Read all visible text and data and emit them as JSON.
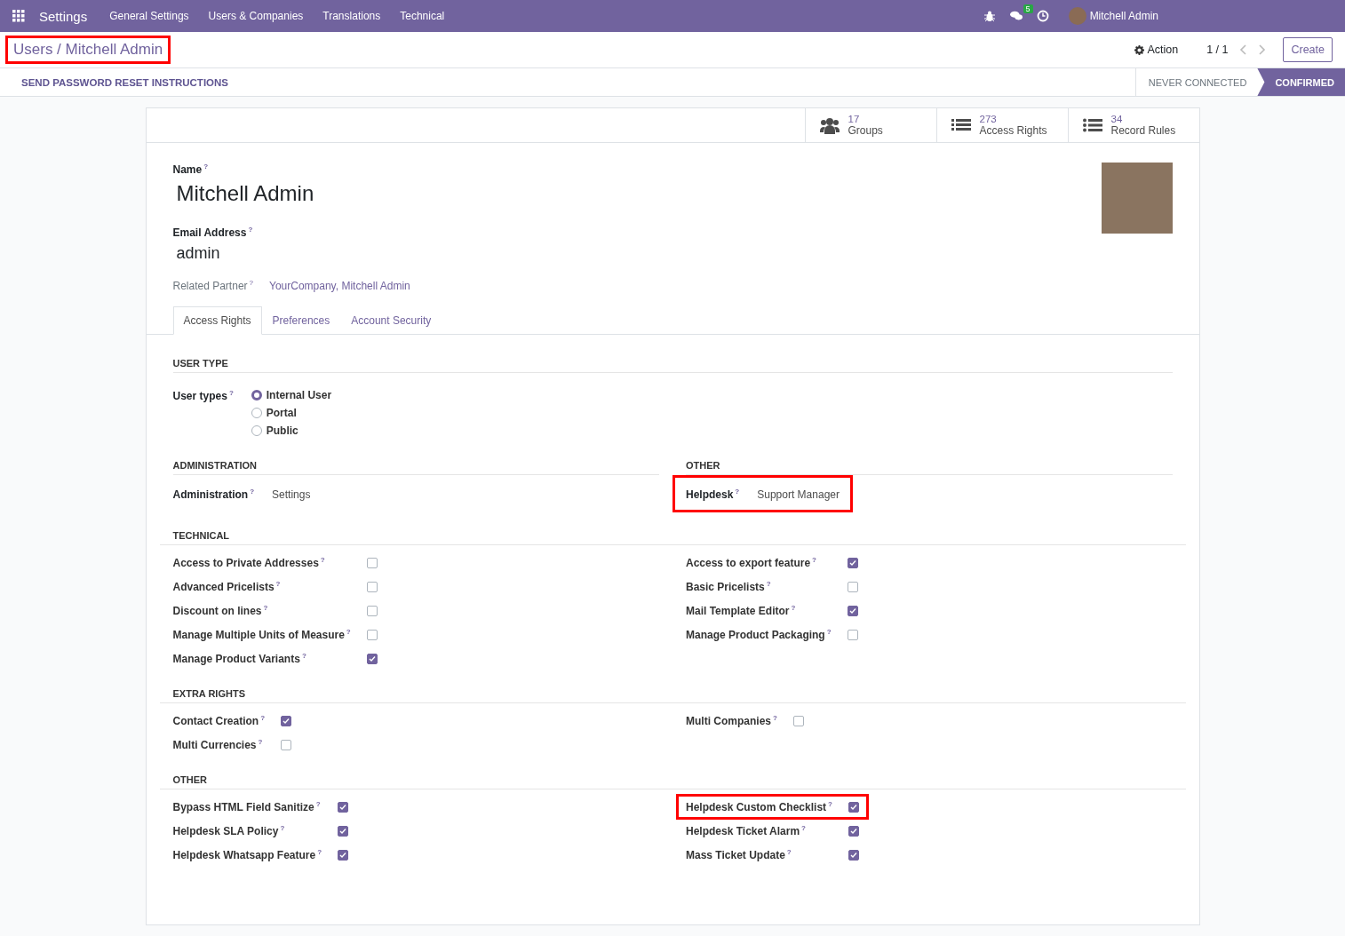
{
  "navbar": {
    "app_name": "Settings",
    "menu": [
      "General Settings",
      "Users & Companies",
      "Translations",
      "Technical"
    ],
    "chat_badge": "5",
    "user_name": "Mitchell Admin"
  },
  "control_panel": {
    "breadcrumb": "Users / Mitchell Admin",
    "breadcrumb_highlighted": true,
    "action": "Action",
    "pager": "1 / 1",
    "create": "Create"
  },
  "status_bar": {
    "button": "SEND PASSWORD RESET INSTRUCTIONS",
    "stages": [
      {
        "label": "NEVER CONNECTED",
        "selected": false
      },
      {
        "label": "CONFIRMED",
        "selected": true
      }
    ]
  },
  "stat_buttons": [
    {
      "kind": "group",
      "value": "17",
      "label": "Groups"
    },
    {
      "kind": "list",
      "value": "273",
      "label": "Access Rights"
    },
    {
      "kind": "bullets",
      "value": "34",
      "label": "Record Rules"
    }
  ],
  "form": {
    "name_label": "Name$^{?}$",
    "name": "Mitchell Admin",
    "email_label": "Email Address$^{?}$",
    "email": "admin",
    "partner_label": "Related Partner$^{?}$",
    "partner": "YourCompany, Mitchell Admin"
  },
  "tabs": [
    {
      "label": "Access Rights",
      "selected": true
    },
    {
      "label": "Preferences",
      "selected": false
    },
    {
      "label": "Account Security",
      "selected": false
    }
  ],
  "sections": [
    {
      "kind": "radio",
      "title": "USER TYPE",
      "label": "User types$^{?}$",
      "options": [
        {
          "label": "Internal User",
          "selected": true
        },
        {
          "label": "Portal",
          "selected": false
        },
        {
          "label": "Public",
          "selected": false
        }
      ]
    },
    {
      "kind": "selects",
      "columns": [
        {
          "title": "ADMINISTRATION",
          "fields": [
            {
              "label": "Administration$^{?}$",
              "value": "Settings",
              "highlighted": false
            }
          ]
        },
        {
          "title": "OTHER",
          "fields": [
            {
              "label": "Helpdesk$^{?}$",
              "value": "Support Manager",
              "highlighted": true
            }
          ]
        }
      ]
    },
    {
      "kind": "checks",
      "title": "TECHNICAL",
      "columns": [
        [
          {
            "label": "Access to Private Addresses$^{?}$",
            "checked": false,
            "highlighted": false
          },
          {
            "label": "Advanced Pricelists$^{?}$",
            "checked": false,
            "highlighted": false
          },
          {
            "label": "Discount on lines$^{?}$",
            "checked": false,
            "highlighted": false
          },
          {
            "label": "Manage Multiple Units of Measure$^{?}$",
            "checked": false,
            "highlighted": false
          },
          {
            "label": "Manage Product Variants$^{?}$",
            "checked": true,
            "highlighted": false
          }
        ],
        [
          {
            "label": "Access to export feature$^{?}$",
            "checked": true,
            "highlighted": false
          },
          {
            "label": "Basic Pricelists$^{?}$",
            "checked": false,
            "highlighted": false
          },
          {
            "label": "Mail Template Editor$^{?}$",
            "checked": true,
            "highlighted": false
          },
          {
            "label": "Manage Product Packaging$^{?}$",
            "checked": false,
            "highlighted": false
          }
        ]
      ]
    },
    {
      "kind": "checks",
      "title": "EXTRA RIGHTS",
      "columns": [
        [
          {
            "label": "Contact Creation$^{?}$",
            "checked": true,
            "highlighted": false
          },
          {
            "label": "Multi Currencies$^{?}$",
            "checked": false,
            "highlighted": false
          }
        ],
        [
          {
            "label": "Multi Companies$^{?}$",
            "checked": false,
            "highlighted": false
          }
        ]
      ]
    },
    {
      "kind": "checks",
      "title": "OTHER",
      "columns": [
        [
          {
            "label": "Bypass HTML Field Sanitize$^{?}$",
            "checked": true,
            "highlighted": false
          },
          {
            "label": "Helpdesk SLA Policy$^{?}$",
            "checked": true,
            "highlighted": false
          },
          {
            "label": "Helpdesk Whatsapp Feature$^{?}$",
            "checked": true,
            "highlighted": false
          }
        ],
        [
          {
            "label": "Helpdesk Custom Checklist$^{?}$",
            "checked": true,
            "highlighted": true
          },
          {
            "label": "Helpdesk Ticket Alarm$^{?}$",
            "checked": true,
            "highlighted": false
          },
          {
            "label": "Mass Ticket Update$^{?}$",
            "checked": true,
            "highlighted": false
          }
        ]
      ]
    }
  ]
}
